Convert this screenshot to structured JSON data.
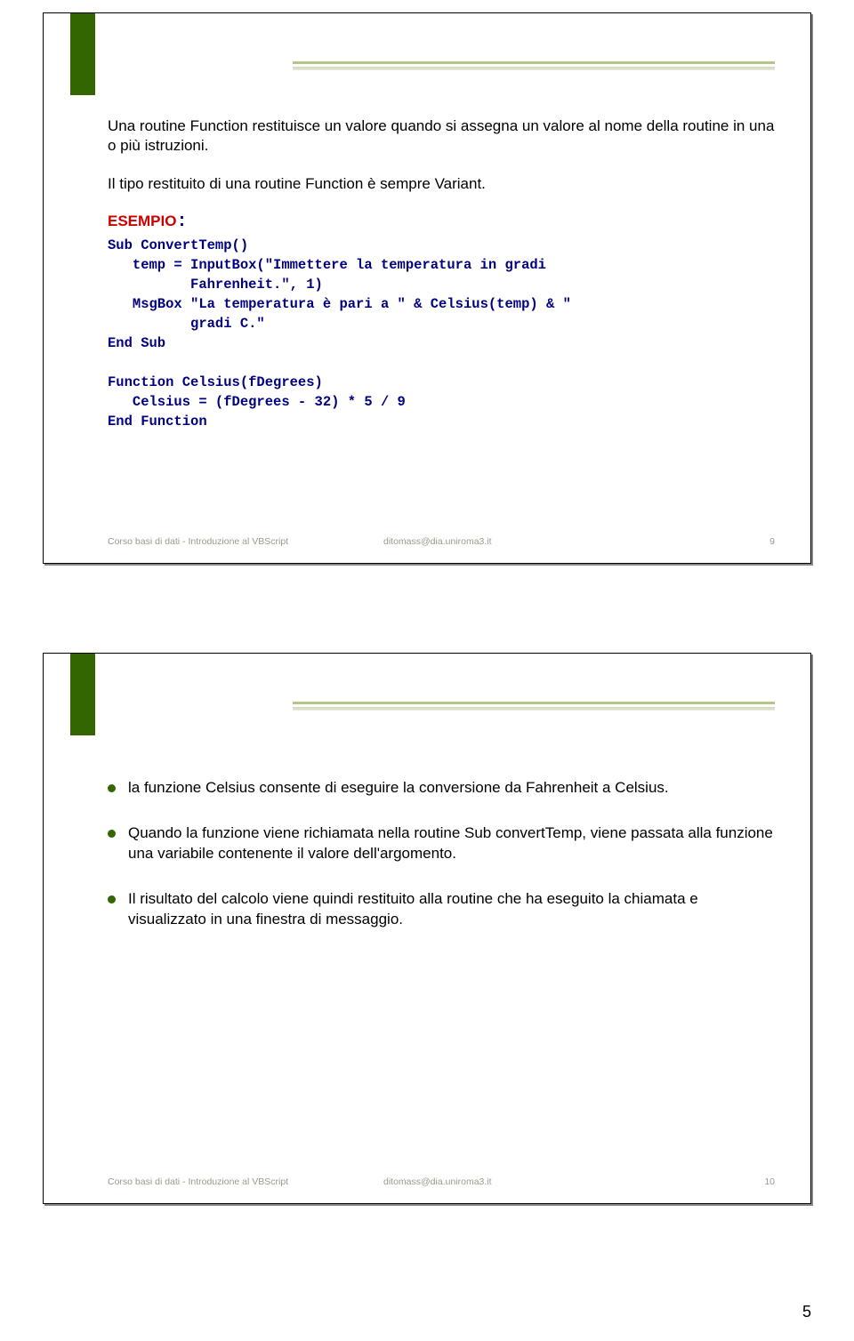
{
  "slide1": {
    "para1": "Una routine Function restituisce un valore quando si assegna un valore al nome della routine in una o più istruzioni.",
    "para2": "Il tipo restituito di una routine Function è sempre Variant.",
    "esempio_label": "ESEMPIO",
    "code": "Sub ConvertTemp()\n   temp = InputBox(\"Immettere la temperatura in gradi \n          Fahrenheit.\", 1)\n   MsgBox \"La temperatura è pari a \" & Celsius(temp) & \" \n          gradi C.\"\nEnd Sub\n\nFunction Celsius(fDegrees)\n   Celsius = (fDegrees - 32) * 5 / 9\nEnd Function",
    "footer_left": "Corso basi di dati - Introduzione al VBScript",
    "footer_mid": "ditomass@dia.uniroma3.it",
    "footer_right": "9"
  },
  "slide2": {
    "b1": "la funzione Celsius consente di eseguire la conversione da Fahrenheit a Celsius.",
    "b2": "Quando la funzione viene richiamata nella routine Sub convertTemp, viene passata alla funzione una variabile contenente il valore dell'argomento.",
    "b3": "Il risultato del calcolo viene quindi restituito alla routine che ha eseguito la chiamata e visualizzato in una finestra di messaggio.",
    "footer_left": "Corso basi di dati - Introduzione al VBScript",
    "footer_mid": "ditomass@dia.uniroma3.it",
    "footer_right": "10"
  },
  "page_number": "5"
}
